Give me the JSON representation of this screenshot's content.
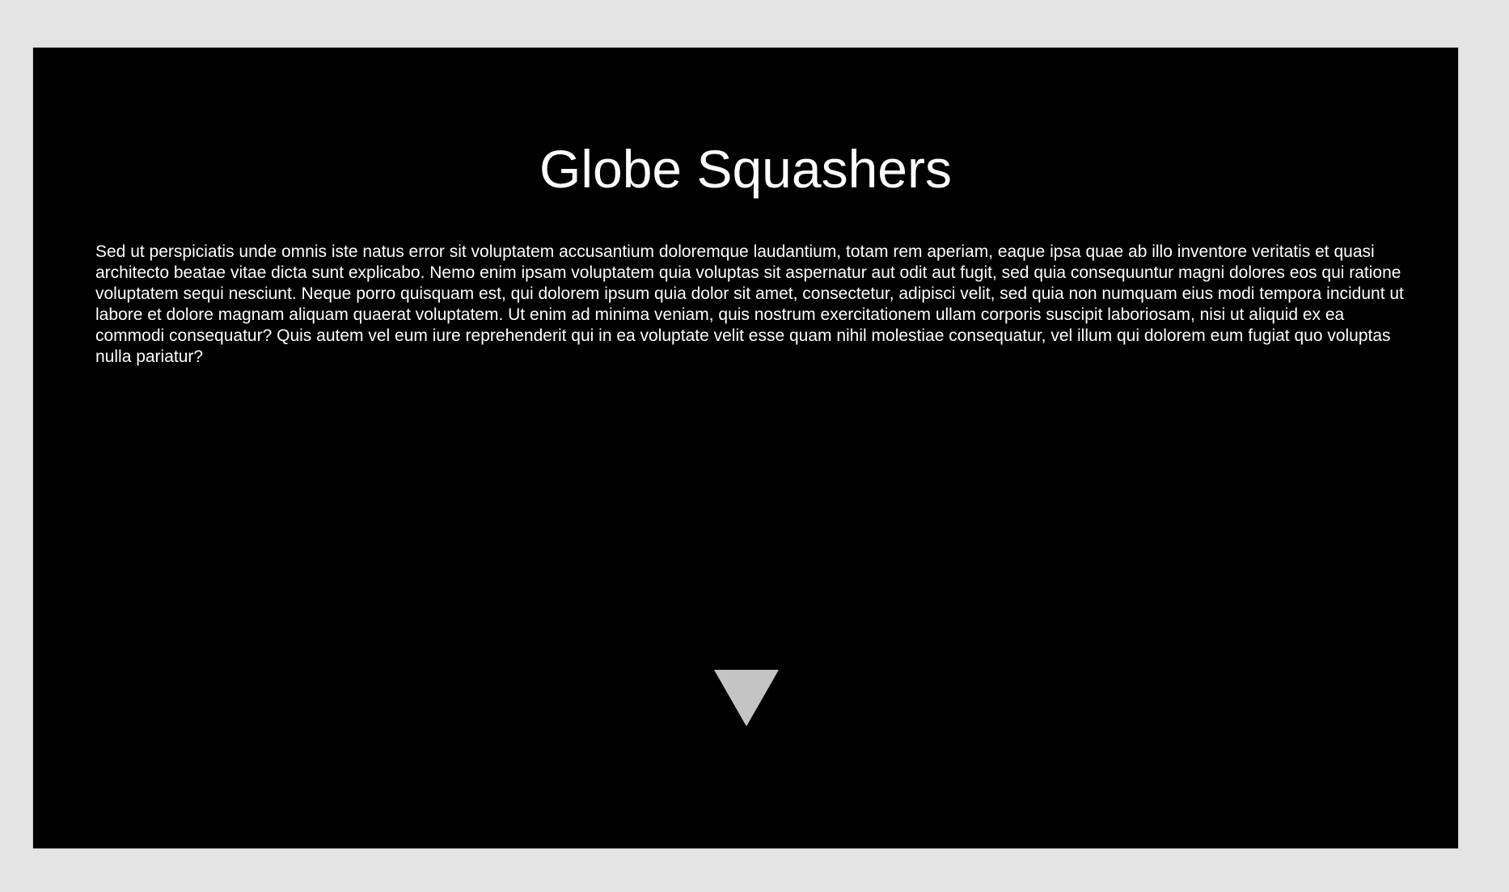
{
  "hero": {
    "title": "Globe Squashers",
    "paragraph": "Sed ut perspiciatis unde omnis iste natus error sit voluptatem accusantium doloremque laudantium, totam rem aperiam, eaque ipsa quae ab illo inventore veritatis et quasi architecto beatae vitae dicta sunt explicabo. Nemo enim ipsam voluptatem quia voluptas sit aspernatur aut odit aut fugit, sed quia consequuntur magni dolores eos qui ratione voluptatem sequi nesciunt. Neque porro quisquam est, qui dolorem ipsum quia dolor sit amet, consectetur, adipisci velit, sed quia non numquam eius modi tempora incidunt ut labore et dolore magnam aliquam quaerat voluptatem. Ut enim ad minima veniam, quis nostrum exercitationem ullam corporis suscipit laboriosam, nisi ut aliquid ex ea commodi consequatur? Quis autem vel eum iure reprehenderit qui in ea voluptate velit esse quam nihil molestiae consequatur, vel illum qui dolorem eum fugiat quo voluptas nulla pariatur?",
    "scroll_icon": "triangle-down-icon"
  },
  "colors": {
    "page_background": "#e4e4e4",
    "panel_background": "#000000",
    "text": "#ffffff",
    "arrow": "#c4c4c4"
  }
}
